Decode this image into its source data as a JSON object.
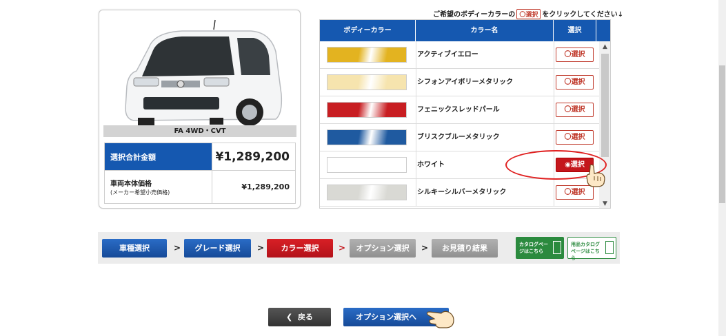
{
  "instruction": {
    "before": "ご希望のボディーカラーの",
    "button": "〇選択",
    "after": "をクリックしてください↓"
  },
  "car": {
    "grade": "FA 4WD・CVT",
    "total_label": "選択合計金額",
    "total_value": "¥1,289,200",
    "base_label": "車両本体価格",
    "base_sub": "(メーカー希望小売価格)",
    "base_value": "¥1,289,200"
  },
  "color_table": {
    "headers": [
      "ボディーカラー",
      "カラー名",
      "選択"
    ],
    "rows": [
      {
        "name": "アクティブイエロー",
        "swatch": "#e3b320",
        "select": "〇選択",
        "selected": false
      },
      {
        "name": "シフォンアイボリーメタリック",
        "swatch": "#f6e4ae",
        "select": "〇選択",
        "selected": false
      },
      {
        "name": "フェニックスレッドパール",
        "swatch": "#c81e22",
        "select": "〇選択",
        "selected": false
      },
      {
        "name": "ブリスクブルーメタリック",
        "swatch": "#1f5aa0",
        "select": "〇選択",
        "selected": false
      },
      {
        "name": "ホワイト",
        "swatch": "#ffffff",
        "select": "◉選択",
        "selected": true
      },
      {
        "name": "シルキーシルバーメタリック",
        "swatch": "#d9d9d4",
        "select": "〇選択",
        "selected": false
      }
    ]
  },
  "steps": [
    {
      "label": "車種選択",
      "state": "done"
    },
    {
      "label": "グレード選択",
      "state": "done"
    },
    {
      "label": "カラー選択",
      "state": "current"
    },
    {
      "label": "オプション選択",
      "state": "todo"
    },
    {
      "label": "お見積り結果",
      "state": "todo"
    }
  ],
  "catalog": {
    "catalog_label": "カタログページはこちら",
    "accessory_label": "用品カタログページはこちら"
  },
  "buttons": {
    "back": "戻る",
    "next": "オプション選択へ"
  },
  "colors": {
    "accent_blue": "#1558b0",
    "accent_red": "#c4161c",
    "catalog_green": "#2b8a3e"
  }
}
